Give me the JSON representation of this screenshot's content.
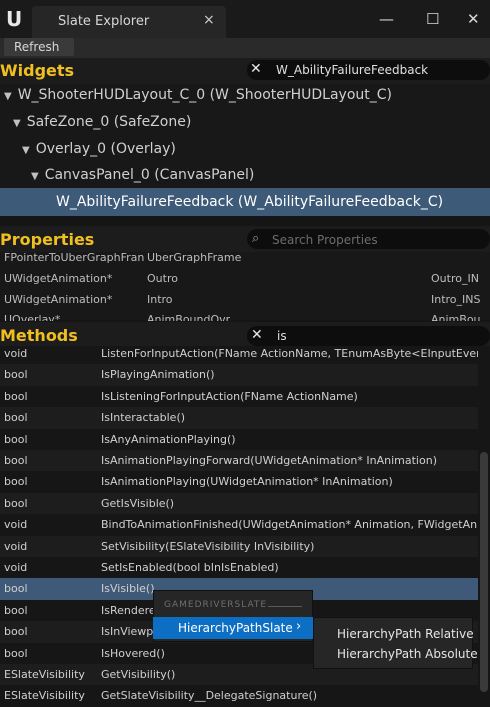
{
  "window": {
    "tab_title": "Slate Explorer",
    "close_glyph": "×",
    "controls": {
      "minimize": "—",
      "maximize": "☐",
      "close": "✕"
    },
    "logo_glyph": "U"
  },
  "toolbar": {
    "refresh_label": "Refresh"
  },
  "widgets": {
    "title": "Widgets",
    "search_value": "W_AbilityFailureFeedback",
    "tree": [
      "W_ShooterHUDLayout_C_0 (W_ShooterHUDLayout_C)",
      "SafeZone_0 (SafeZone)",
      "Overlay_0 (Overlay)",
      "CanvasPanel_0 (CanvasPanel)",
      "W_AbilityFailureFeedback (W_AbilityFailureFeedback_C)"
    ]
  },
  "properties": {
    "title": "Properties",
    "search_placeholder": "Search Properties",
    "rows": [
      [
        "FPointerToUberGraphFran",
        "UberGraphFrame",
        ""
      ],
      [
        "UWidgetAnimation*",
        "Outro",
        "Outro_IN"
      ],
      [
        "UWidgetAnimation*",
        "Intro",
        "Intro_INS"
      ],
      [
        "UOverlay*",
        "AnimBoundOvr",
        "AnimBou"
      ]
    ]
  },
  "methods": {
    "title": "Methods",
    "search_value": "is",
    "rows": [
      [
        "void",
        "ListenForInputAction(FName ActionName, TEnumAsByte<EInputEvent>"
      ],
      [
        "bool",
        "IsPlayingAnimation()"
      ],
      [
        "bool",
        "IsListeningForInputAction(FName ActionName)"
      ],
      [
        "bool",
        "IsInteractable()"
      ],
      [
        "bool",
        "IsAnyAnimationPlaying()"
      ],
      [
        "bool",
        "IsAnimationPlayingForward(UWidgetAnimation* InAnimation)"
      ],
      [
        "bool",
        "IsAnimationPlaying(UWidgetAnimation* InAnimation)"
      ],
      [
        "bool",
        "GetIsVisible()"
      ],
      [
        "void",
        "BindToAnimationFinished(UWidgetAnimation* Animation, FWidgetAnima"
      ],
      [
        "void",
        "SetVisibility(ESlateVisibility InVisibility)"
      ],
      [
        "void",
        "SetIsEnabled(bool bInIsEnabled)"
      ],
      [
        "bool",
        "IsVisible()"
      ],
      [
        "bool",
        "IsRendere"
      ],
      [
        "bool",
        "IsInViewp"
      ],
      [
        "bool",
        "IsHovered()"
      ],
      [
        "ESlateVisibility",
        "GetVisibility()"
      ],
      [
        "ESlateVisibility",
        "GetSlateVisibility__DelegateSignature()"
      ]
    ]
  },
  "context_menu": {
    "header": "GAMEDRIVERSLATE",
    "item": "HierarchyPathSlate",
    "chevron": "›",
    "submenu": [
      "HierarchyPath Relative",
      "HierarchyPath Absolute"
    ]
  }
}
